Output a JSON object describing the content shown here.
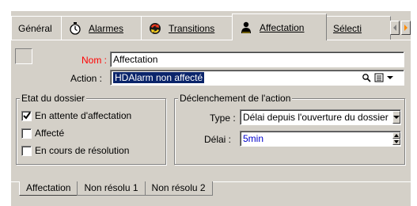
{
  "tabs": [
    {
      "label": "Général",
      "icon": "none"
    },
    {
      "label": "Alarmes",
      "icon": "stopwatch-icon"
    },
    {
      "label": "Transitions",
      "icon": "transitions-icon"
    },
    {
      "label": "Affectation",
      "icon": "person-icon"
    },
    {
      "label": "Sélecti",
      "icon": "none"
    }
  ],
  "active_tab": "Affectation",
  "form": {
    "nom_label": "Nom :",
    "nom_value": "Affectation",
    "action_label": "Action :",
    "action_value": "HDAlarm non affecté"
  },
  "etat": {
    "title": "Etat du dossier",
    "options": [
      {
        "label": "En attente d'affectation",
        "checked": true
      },
      {
        "label": "Affecté",
        "checked": false
      },
      {
        "label": "En cours de résolution",
        "checked": false
      }
    ]
  },
  "declenchement": {
    "title": "Déclenchement de l'action",
    "type_label": "Type :",
    "type_value": "Délai depuis l'ouverture du dossier",
    "delai_label": "Délai :",
    "delai_value": "5min"
  },
  "bottom_tabs": [
    "Affectation",
    "Non résolu 1",
    "Non résolu 2"
  ],
  "colors": {
    "face": "#d4d0c8",
    "label_red": "#ff0000",
    "selection": "#0a246a",
    "value_blue": "#0000cc"
  }
}
